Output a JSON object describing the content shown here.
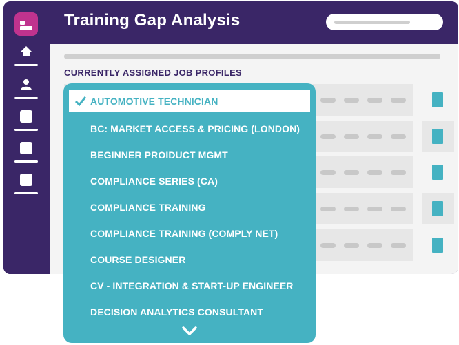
{
  "header": {
    "title": "Training Gap Analysis"
  },
  "section": {
    "label": "CURRENTLY ASSIGNED JOB PROFILES"
  },
  "dropdown": {
    "options": [
      "AUTOMOTIVE TECHNICIAN",
      "BC: MARKET ACCESS & PRICING (LONDON)",
      "BEGINNER PROIDUCT MGMT",
      "COMPLIANCE SERIES (CA)",
      "COMPLIANCE TRAINING",
      "COMPLIANCE TRAINING (COMPLY NET)",
      "COURSE DESIGNER",
      "CV - INTEGRATION & START-UP ENGINEER",
      "DECISION ANALYTICS CONSULTANT"
    ],
    "selected_index": 0
  },
  "colors": {
    "brand_purple": "#3a2667",
    "logo_magenta": "#c0338e",
    "accent_teal": "#45b2c2"
  },
  "icons": {
    "logo": "app-logo-icon",
    "nav": [
      "home-icon",
      "user-icon",
      "document-icon",
      "document-icon",
      "document-icon"
    ],
    "check": "check-icon",
    "scroll_more": "chevron-down-icon"
  }
}
